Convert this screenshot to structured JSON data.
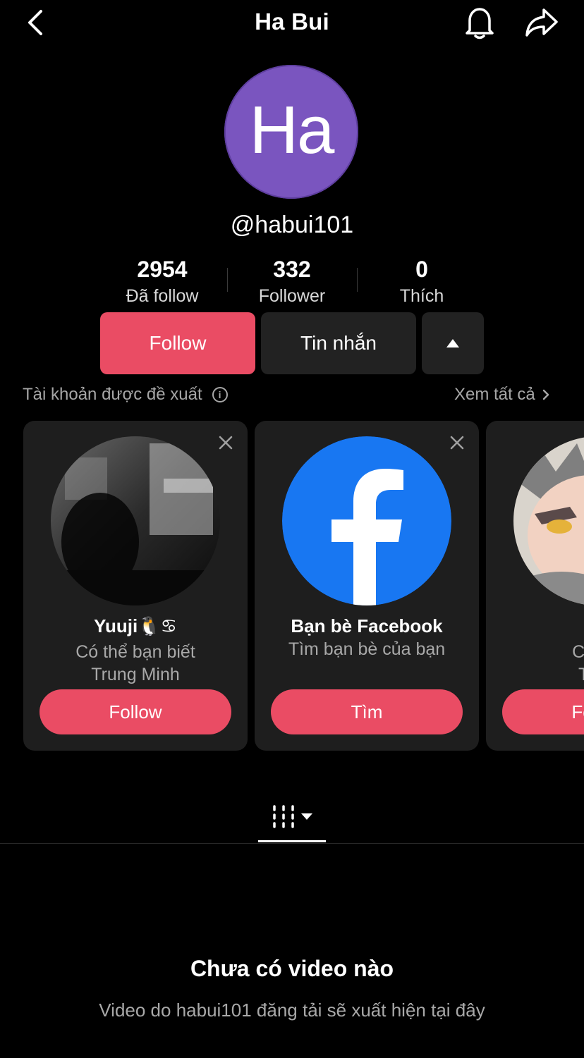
{
  "header": {
    "title": "Ha Bui",
    "back_icon": "chevron-left-icon",
    "bell_icon": "bell-icon",
    "share_icon": "share-arrow-icon"
  },
  "profile": {
    "avatar_initials": "Ha",
    "avatar_color": "#7a55bf",
    "username": "@habui101"
  },
  "stats": [
    {
      "value": "2954",
      "label": "Đã follow"
    },
    {
      "value": "332",
      "label": "Follower"
    },
    {
      "value": "0",
      "label": "Thích"
    }
  ],
  "actions": {
    "follow_label": "Follow",
    "message_label": "Tin nhắn",
    "more_icon": "caret-up-icon",
    "accent": "#ea4c64"
  },
  "suggested": {
    "title": "Tài khoản được đề xuất",
    "see_all": "Xem tất cả",
    "cards": [
      {
        "name": "Yuuji🐧♋",
        "line1": "Có thể bạn biết",
        "line2": "Trung Minh",
        "button": "Follow"
      },
      {
        "name": "Bạn bè Facebook",
        "line1": "Tìm bạn bè của bạn",
        "line2": "",
        "button": "Tìm"
      },
      {
        "name": "",
        "line1": "Có thể",
        "line2": "Tuấn",
        "button": "Follow"
      }
    ]
  },
  "tabs": {
    "grid_icon": "grid-icon"
  },
  "empty_state": {
    "title": "Chưa có video nào",
    "subtitle": "Video do habui101 đăng tải sẽ xuất hiện tại đây"
  }
}
